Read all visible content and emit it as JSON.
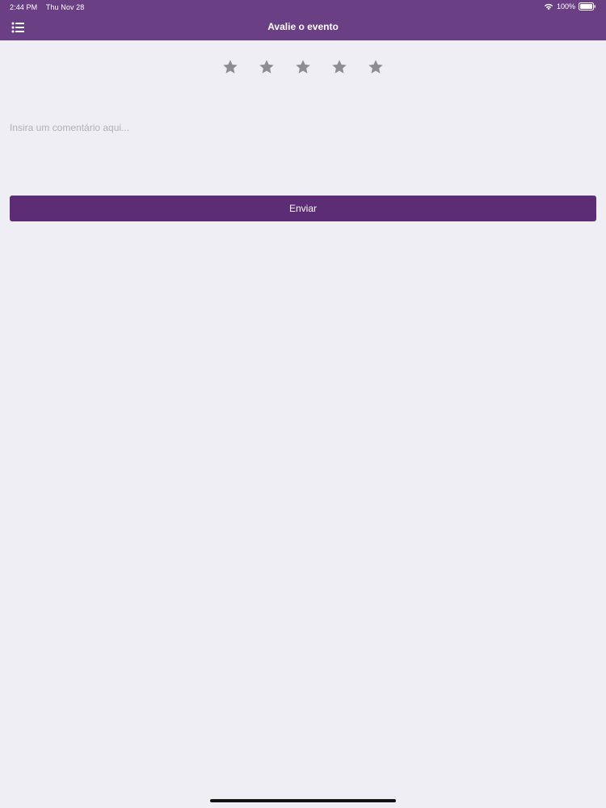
{
  "status_bar": {
    "time": "2:44 PM",
    "date": "Thu Nov 28",
    "battery": "100%",
    "icons": [
      "wifi-icon",
      "battery-icon"
    ]
  },
  "header": {
    "title": "Avalie o evento",
    "menu_icon": "list-menu-icon"
  },
  "rating": {
    "value": 0,
    "max": 5,
    "star_icon": "star-icon",
    "star_color": "#8e8d93"
  },
  "comment": {
    "value": "",
    "placeholder": "Insira um comentário aqui..."
  },
  "submit": {
    "label": "Enviar"
  },
  "colors": {
    "header_bg": "#6a3f84",
    "button_bg": "#5c2c75",
    "page_bg": "#efeef4"
  }
}
